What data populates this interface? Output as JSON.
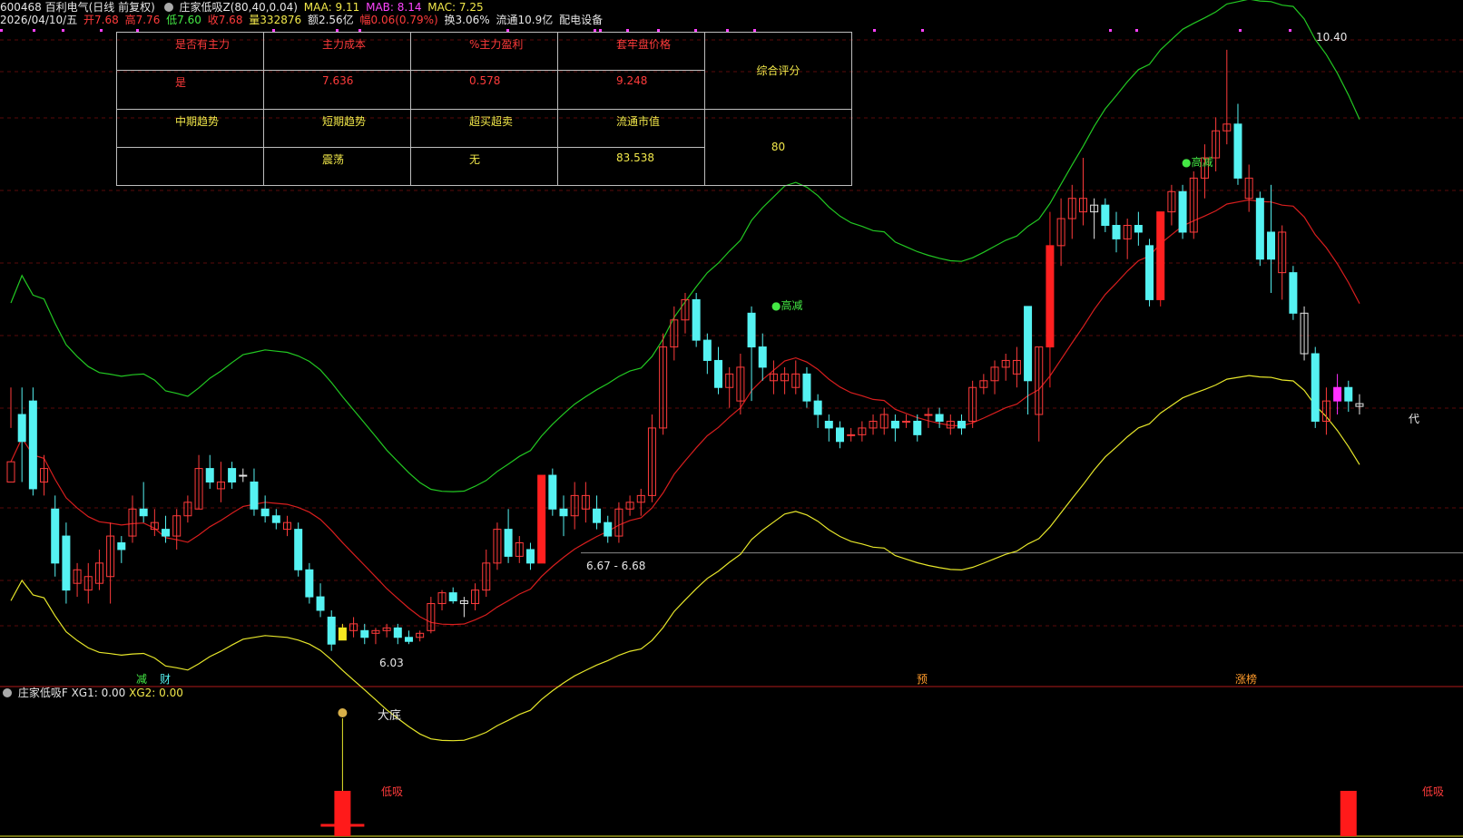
{
  "header": {
    "code_name": "600468 百利电气(日线 前复权)",
    "indicator": "庄家低吸Z(80,40,0.04)",
    "maa": "MAA: 9.11",
    "mab": "MAB: 8.14",
    "mac": "MAC: 7.25",
    "date": "2026/04/10/五",
    "open": "开7.68",
    "high": "高7.76",
    "low": "低7.60",
    "close": "收7.68",
    "volume": "量332876",
    "amount": "额2.56亿",
    "change": "幅0.06(0.79%)",
    "turnover": "换3.06%",
    "float": "流通10.9亿",
    "sector": "配电设备"
  },
  "table": {
    "row1": [
      "是否有主力",
      "主力成本",
      "%主力盈利",
      "套牢盘价格"
    ],
    "row2": [
      "是",
      "7.636",
      "0.578",
      "9.248"
    ],
    "row3": [
      "中期趋势",
      "短期趋势",
      "超买超卖",
      "流通市值"
    ],
    "row4": [
      "",
      "震荡",
      "无",
      "83.538"
    ],
    "score_label": "综合评分",
    "score_value": "80"
  },
  "annotations": {
    "peak_price": "10.40",
    "low_price": "6.03",
    "range_label": "6.67 - 6.68",
    "high_reduce_1": "●高减",
    "high_reduce_2": "●高减",
    "signal_reduce": "减",
    "signal_cai": "财",
    "signal_yu": "预",
    "signal_zt": "涨榜",
    "signal_dai": "代"
  },
  "sub": {
    "title": "庄家低吸F",
    "xg1": "XG1: 0.00",
    "xg2": "XG2: 0.00",
    "big_bottom": "大底",
    "low_buy_1": "低吸",
    "low_buy_2": "低吸"
  },
  "colors": {
    "up": "#ff3b3b",
    "down": "#55f2f2",
    "upper_band": "#22c822",
    "mid_band": "#d81e1e",
    "lower_band": "#e6e62a"
  },
  "chart_data": {
    "type": "candlestick",
    "price_range": [
      5.8,
      10.5
    ],
    "candles": [
      [
        7.2,
        7.9,
        7.6,
        7.35,
        "u"
      ],
      [
        7.5,
        7.9,
        7.2,
        7.7,
        "d"
      ],
      [
        7.8,
        7.9,
        7.1,
        7.15,
        "d"
      ],
      [
        7.2,
        7.4,
        7.1,
        7.3,
        "u"
      ],
      [
        7.0,
        7.1,
        6.5,
        6.6,
        "d"
      ],
      [
        6.8,
        6.9,
        6.3,
        6.4,
        "d"
      ],
      [
        6.45,
        6.6,
        6.35,
        6.55,
        "u"
      ],
      [
        6.4,
        6.6,
        6.3,
        6.5,
        "u"
      ],
      [
        6.45,
        6.7,
        6.4,
        6.6,
        "u"
      ],
      [
        6.5,
        6.9,
        6.3,
        6.8,
        "u"
      ],
      [
        6.7,
        6.8,
        6.6,
        6.75,
        "d"
      ],
      [
        6.8,
        7.1,
        6.75,
        7.0,
        "u"
      ],
      [
        7.0,
        7.2,
        6.9,
        6.95,
        "d"
      ],
      [
        6.9,
        7.0,
        6.8,
        6.85,
        "u"
      ],
      [
        6.85,
        6.95,
        6.75,
        6.8,
        "d"
      ],
      [
        6.8,
        7.0,
        6.7,
        6.95,
        "u"
      ],
      [
        6.95,
        7.1,
        6.9,
        7.05,
        "u"
      ],
      [
        7.0,
        7.4,
        7.0,
        7.3,
        "u"
      ],
      [
        7.3,
        7.4,
        7.15,
        7.2,
        "d"
      ],
      [
        7.2,
        7.35,
        7.05,
        7.15,
        "u"
      ],
      [
        7.3,
        7.35,
        7.15,
        7.2,
        "d"
      ],
      [
        7.25,
        7.3,
        7.2,
        7.25,
        "n"
      ],
      [
        7.2,
        7.3,
        6.95,
        7.0,
        "d"
      ],
      [
        7.0,
        7.1,
        6.9,
        6.95,
        "d"
      ],
      [
        6.95,
        7.0,
        6.85,
        6.9,
        "d"
      ],
      [
        6.9,
        6.95,
        6.8,
        6.85,
        "u"
      ],
      [
        6.85,
        6.9,
        6.5,
        6.55,
        "d"
      ],
      [
        6.55,
        6.6,
        6.3,
        6.35,
        "d"
      ],
      [
        6.35,
        6.45,
        6.2,
        6.25,
        "d"
      ],
      [
        6.2,
        6.25,
        5.95,
        6.0,
        "d"
      ],
      [
        6.03,
        6.15,
        6.03,
        6.12,
        "y"
      ],
      [
        6.15,
        6.2,
        6.05,
        6.1,
        "u"
      ],
      [
        6.1,
        6.15,
        6.0,
        6.05,
        "d"
      ],
      [
        6.08,
        6.12,
        6.0,
        6.1,
        "u"
      ],
      [
        6.1,
        6.15,
        6.05,
        6.12,
        "u"
      ],
      [
        6.12,
        6.15,
        6.0,
        6.05,
        "d"
      ],
      [
        6.05,
        6.1,
        6.0,
        6.02,
        "d"
      ],
      [
        6.05,
        6.1,
        6.02,
        6.08,
        "u"
      ],
      [
        6.1,
        6.35,
        6.08,
        6.3,
        "u"
      ],
      [
        6.3,
        6.4,
        6.25,
        6.38,
        "u"
      ],
      [
        6.38,
        6.42,
        6.3,
        6.32,
        "d"
      ],
      [
        6.32,
        6.35,
        6.2,
        6.3,
        "n"
      ],
      [
        6.3,
        6.45,
        6.25,
        6.4,
        "u"
      ],
      [
        6.4,
        6.7,
        6.35,
        6.6,
        "u"
      ],
      [
        6.6,
        6.9,
        6.55,
        6.85,
        "u"
      ],
      [
        6.85,
        7.0,
        6.6,
        6.65,
        "d"
      ],
      [
        6.65,
        6.8,
        6.6,
        6.75,
        "u"
      ],
      [
        6.7,
        6.75,
        6.55,
        6.6,
        "d"
      ],
      [
        6.6,
        7.25,
        6.6,
        7.25,
        "r"
      ],
      [
        7.25,
        7.3,
        6.95,
        7.0,
        "d"
      ],
      [
        7.0,
        7.1,
        6.8,
        6.95,
        "d"
      ],
      [
        6.95,
        7.2,
        6.85,
        7.1,
        "u"
      ],
      [
        7.1,
        7.2,
        6.9,
        7.0,
        "u"
      ],
      [
        7.0,
        7.1,
        6.85,
        6.9,
        "d"
      ],
      [
        6.9,
        6.95,
        6.75,
        6.8,
        "d"
      ],
      [
        6.8,
        7.05,
        6.75,
        7.0,
        "u"
      ],
      [
        7.0,
        7.1,
        6.95,
        7.05,
        "u"
      ],
      [
        7.05,
        7.15,
        6.95,
        7.1,
        "u"
      ],
      [
        7.1,
        7.7,
        7.05,
        7.6,
        "u"
      ],
      [
        7.6,
        8.3,
        7.55,
        8.2,
        "u"
      ],
      [
        8.2,
        8.5,
        8.1,
        8.4,
        "u"
      ],
      [
        8.4,
        8.6,
        8.3,
        8.55,
        "u"
      ],
      [
        8.55,
        8.6,
        8.2,
        8.25,
        "d"
      ],
      [
        8.25,
        8.3,
        8.0,
        8.1,
        "d"
      ],
      [
        8.1,
        8.2,
        7.85,
        7.9,
        "d"
      ],
      [
        7.9,
        8.05,
        7.75,
        8.0,
        "u"
      ],
      [
        8.05,
        8.15,
        7.7,
        7.8,
        "u"
      ],
      [
        8.2,
        8.5,
        7.8,
        8.45,
        "d"
      ],
      [
        8.2,
        8.3,
        7.95,
        8.05,
        "d"
      ],
      [
        8.0,
        8.1,
        7.85,
        7.95,
        "u"
      ],
      [
        7.95,
        8.05,
        7.85,
        8.0,
        "u"
      ],
      [
        8.0,
        8.1,
        7.85,
        7.9,
        "u"
      ],
      [
        8.0,
        8.05,
        7.75,
        7.8,
        "d"
      ],
      [
        7.8,
        7.85,
        7.6,
        7.7,
        "d"
      ],
      [
        7.65,
        7.7,
        7.5,
        7.6,
        "d"
      ],
      [
        7.6,
        7.65,
        7.45,
        7.5,
        "d"
      ],
      [
        7.55,
        7.6,
        7.5,
        7.55,
        "u"
      ],
      [
        7.55,
        7.65,
        7.5,
        7.6,
        "u"
      ],
      [
        7.6,
        7.7,
        7.55,
        7.65,
        "u"
      ],
      [
        7.6,
        7.75,
        7.55,
        7.7,
        "u"
      ],
      [
        7.65,
        7.7,
        7.5,
        7.6,
        "d"
      ],
      [
        7.65,
        7.7,
        7.6,
        7.65,
        "u"
      ],
      [
        7.65,
        7.7,
        7.5,
        7.55,
        "d"
      ],
      [
        7.7,
        7.75,
        7.6,
        7.7,
        "u"
      ],
      [
        7.7,
        7.75,
        7.6,
        7.65,
        "d"
      ],
      [
        7.65,
        7.7,
        7.55,
        7.6,
        "u"
      ],
      [
        7.6,
        7.7,
        7.55,
        7.65,
        "d"
      ],
      [
        7.65,
        7.95,
        7.6,
        7.9,
        "u"
      ],
      [
        7.9,
        8.0,
        7.85,
        7.95,
        "u"
      ],
      [
        7.95,
        8.1,
        7.85,
        8.05,
        "u"
      ],
      [
        8.05,
        8.15,
        7.95,
        8.1,
        "u"
      ],
      [
        8.1,
        8.2,
        7.9,
        8.0,
        "u"
      ],
      [
        7.95,
        8.5,
        7.7,
        8.5,
        "d"
      ],
      [
        7.7,
        8.2,
        7.5,
        8.2,
        "u"
      ],
      [
        8.2,
        9.2,
        7.9,
        8.95,
        "r"
      ],
      [
        8.95,
        9.3,
        8.8,
        9.15,
        "u"
      ],
      [
        9.15,
        9.4,
        9.0,
        9.3,
        "u"
      ],
      [
        9.3,
        9.6,
        9.1,
        9.2,
        "u"
      ],
      [
        9.2,
        9.3,
        9.0,
        9.25,
        "n"
      ],
      [
        9.25,
        9.3,
        9.05,
        9.1,
        "d"
      ],
      [
        9.1,
        9.2,
        8.9,
        9.0,
        "d"
      ],
      [
        9.0,
        9.15,
        8.85,
        9.1,
        "u"
      ],
      [
        9.1,
        9.2,
        8.95,
        9.05,
        "d"
      ],
      [
        8.95,
        9.0,
        8.5,
        8.55,
        "d"
      ],
      [
        8.55,
        9.2,
        8.5,
        9.2,
        "r"
      ],
      [
        9.2,
        9.4,
        9.1,
        9.35,
        "u"
      ],
      [
        9.35,
        9.4,
        9.0,
        9.05,
        "d"
      ],
      [
        9.05,
        9.5,
        9.0,
        9.45,
        "u"
      ],
      [
        9.45,
        9.7,
        9.3,
        9.6,
        "u"
      ],
      [
        9.6,
        9.9,
        9.5,
        9.8,
        "u"
      ],
      [
        9.8,
        10.4,
        9.7,
        9.85,
        "u"
      ],
      [
        9.85,
        10.0,
        9.4,
        9.45,
        "d"
      ],
      [
        9.45,
        9.55,
        9.2,
        9.3,
        "u"
      ],
      [
        9.3,
        9.35,
        8.8,
        8.85,
        "d"
      ],
      [
        8.85,
        9.4,
        8.6,
        9.05,
        "d"
      ],
      [
        9.05,
        9.1,
        8.55,
        8.75,
        "u"
      ],
      [
        8.75,
        8.8,
        8.4,
        8.45,
        "d"
      ],
      [
        8.45,
        8.5,
        8.1,
        8.15,
        "n"
      ],
      [
        8.15,
        8.2,
        7.6,
        7.65,
        "d"
      ],
      [
        7.65,
        7.9,
        7.55,
        7.8,
        "u"
      ],
      [
        7.8,
        8.0,
        7.7,
        7.9,
        "m"
      ],
      [
        7.9,
        7.95,
        7.72,
        7.8,
        "d"
      ],
      [
        7.76,
        7.85,
        7.7,
        7.78,
        "n"
      ]
    ]
  }
}
